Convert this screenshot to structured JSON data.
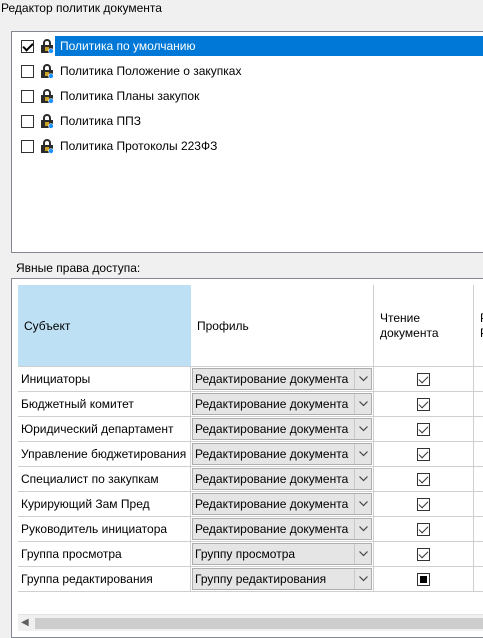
{
  "window": {
    "title": "Редактор политик документа"
  },
  "policies": [
    {
      "label": "Политика по умолчанию",
      "checked": true,
      "selected": true
    },
    {
      "label": "Политика Положение о закупках",
      "checked": false,
      "selected": false
    },
    {
      "label": "Политика Планы закупок",
      "checked": false,
      "selected": false
    },
    {
      "label": "Политика ППЗ",
      "checked": false,
      "selected": false
    },
    {
      "label": "Политика Протоколы 223ФЗ",
      "checked": false,
      "selected": false
    }
  ],
  "explicit_rights": {
    "label": "Явные права доступа:",
    "headers": {
      "subject": "Субъект",
      "profile": "Профиль",
      "reading_line1": "Чтение",
      "reading_line2": "документа",
      "next_col_partial1": "Р",
      "next_col_partial2": "Р"
    },
    "rows": [
      {
        "subject": "Инициаторы",
        "profile": "Редактирование документа",
        "reading": "checked"
      },
      {
        "subject": "Бюджетный комитет",
        "profile": "Редактирование документа",
        "reading": "checked"
      },
      {
        "subject": "Юридический департамент",
        "profile": "Редактирование документа",
        "reading": "checked"
      },
      {
        "subject": "Управление бюджетирования",
        "profile": "Редактирование документа",
        "reading": "checked"
      },
      {
        "subject": "Специалист по закупкам",
        "profile": "Редактирование документа",
        "reading": "checked"
      },
      {
        "subject": "Курирующий Зам Пред",
        "profile": "Редактирование документа",
        "reading": "checked"
      },
      {
        "subject": "Руководитель инициатора",
        "profile": "Редактирование документа",
        "reading": "checked"
      },
      {
        "subject": "Группа просмотра",
        "profile": "Группу просмотра",
        "reading": "checked"
      },
      {
        "subject": "Группа редактирования",
        "profile": "Группу редактирования",
        "reading": "indeterminate"
      }
    ]
  },
  "icons": {
    "policy": "lock-icon",
    "dropdown": "chevron-down-icon",
    "scroll_left": "arrow-left-icon"
  },
  "colors": {
    "selection": "#0078d7",
    "subject_header": "#bee0f5"
  }
}
